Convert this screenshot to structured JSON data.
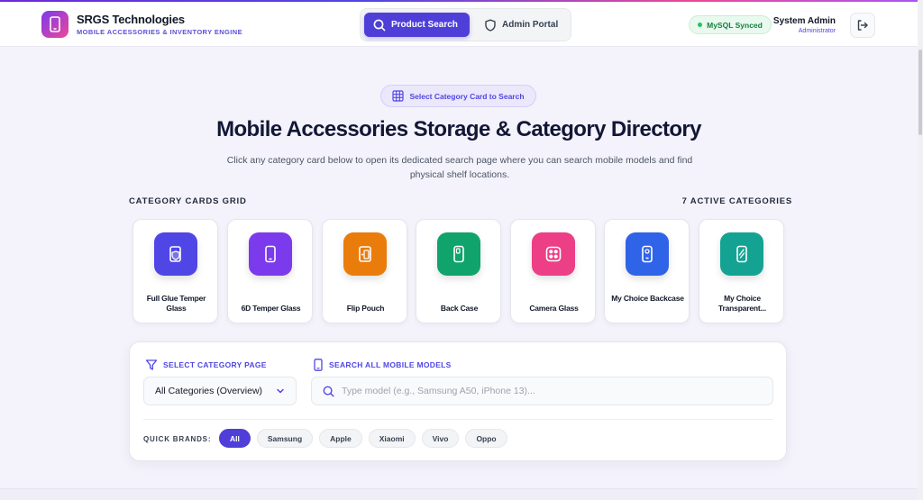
{
  "brand": {
    "name": "SRGS Technologies",
    "tagline": "MOBILE ACCESSORIES & INVENTORY ENGINE"
  },
  "nav": {
    "product_search": "Product Search",
    "admin_portal": "Admin Portal"
  },
  "status": {
    "sync_label": "MySQL Synced"
  },
  "user": {
    "name": "System Admin",
    "role": "Administrator"
  },
  "hero": {
    "pill": "Select Category Card to Search",
    "title": "Mobile Accessories Storage & Category Directory",
    "subtitle": "Click any category card below to open its dedicated search page where you can search mobile models and find physical shelf locations."
  },
  "grid": {
    "label": "CATEGORY CARDS GRID",
    "count": "7 ACTIVE CATEGORIES"
  },
  "categories": [
    {
      "label": "Full Glue Temper Glass",
      "icon": "shield-phone-icon",
      "color": "#4f46e5"
    },
    {
      "label": "6D Temper Glass",
      "icon": "smartphone-icon",
      "color": "#7c3aed"
    },
    {
      "label": "Flip Pouch",
      "icon": "flip-cover-icon",
      "color": "#ea7c0c"
    },
    {
      "label": "Back Case",
      "icon": "back-case-icon",
      "color": "#10a36b"
    },
    {
      "label": "Camera Glass",
      "icon": "camera-lens-icon",
      "color": "#ec3f86"
    },
    {
      "label": "My Choice Backcase",
      "icon": "backcase-camera-icon",
      "color": "#2f63e8"
    },
    {
      "label": "My Choice Transparent...",
      "icon": "transparent-case-icon",
      "color": "#14a393"
    }
  ],
  "filters": {
    "category_label": "SELECT CATEGORY PAGE",
    "category_value": "All Categories (Overview)",
    "search_label": "SEARCH ALL MOBILE MODELS",
    "search_placeholder": "Type model (e.g., Samsung A50, iPhone 13)...",
    "quick_brands_label": "QUICK BRANDS:",
    "brands": [
      "All",
      "Samsung",
      "Apple",
      "Xiaomi",
      "Vivo",
      "Oppo"
    ]
  }
}
